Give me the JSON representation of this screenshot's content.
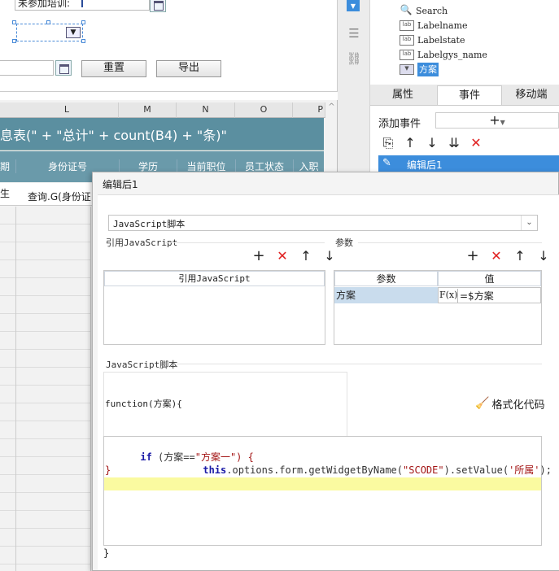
{
  "form": {
    "training_label": "未参加培训:",
    "reset_button": "重置",
    "export_button": "导出"
  },
  "sheet": {
    "col_L": "L",
    "col_M": "M",
    "col_N": "N",
    "col_O": "O",
    "col_P": "P",
    "title_formula": "息表(\" + \"总计\" + count(B4) + \"条)\"",
    "headers": [
      "期",
      "身份证号",
      "学历",
      "当前职位",
      "员工状态",
      "入职"
    ],
    "row1_a": "生",
    "row1_b": "查询.G(身份证"
  },
  "widget_tree": {
    "items": [
      {
        "label": "Search",
        "icon": "search-icon"
      },
      {
        "label": "Labelname",
        "icon": "label-icon"
      },
      {
        "label": "Labelstate",
        "icon": "label-icon"
      },
      {
        "label": "Labelgys_name",
        "icon": "label-icon"
      },
      {
        "label": "方案",
        "icon": "combo-icon"
      }
    ]
  },
  "panel": {
    "tabs": [
      "属性",
      "事件",
      "移动端"
    ],
    "add_event": "添加事件",
    "event_item": "编辑后1"
  },
  "dialog": {
    "title": "编辑后1",
    "type_select": "JavaScript脚本",
    "ref_js_section": "引用JavaScript",
    "ref_js_header": "引用JavaScript",
    "params_section": "参数",
    "param_col": "参数",
    "value_col": "值",
    "param_name": "方案",
    "param_fx": "F(x)",
    "param_value": "=$方案",
    "script_section": "JavaScript脚本",
    "function_sig": "function(方案){",
    "format_code": "格式化代码",
    "code_line1_kw": "if",
    "code_line1_rest": " (方案==",
    "code_line1_str": "\"方案一\"",
    "code_line1_end": ") {",
    "code_line2_this": "this",
    "code_line2_mid": ".options.form.getWidgetByName(",
    "code_line2_arg": "\"SCODE\"",
    "code_line2_mid2": ").setValue(",
    "code_line2_val": "'所属'",
    "code_line2_end": ");",
    "code_line3": "}",
    "closing_brace": "}"
  },
  "colors": {
    "sheet_header_bg": "#5b8fa0",
    "selection_blue": "#3c8ddc",
    "param_cell_bg": "#c9dced",
    "highlight_line": "#fafaa0",
    "keyword_blue": "#1a1aa6",
    "string_red": "#a31515",
    "delete_red": "#e02020"
  }
}
